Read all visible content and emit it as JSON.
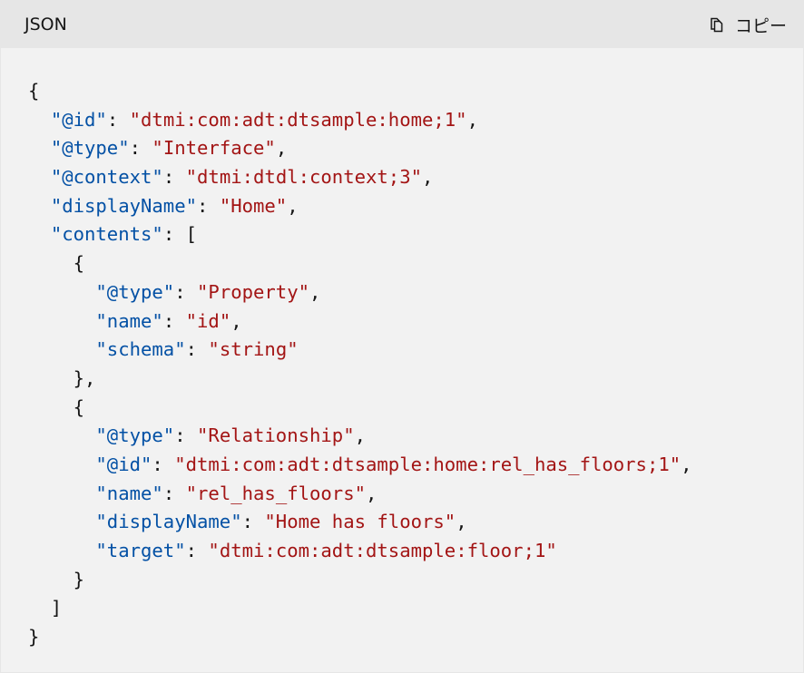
{
  "header": {
    "language": "JSON",
    "copy_label": "コピー"
  },
  "icons": {
    "copy": "copy-icon"
  },
  "colors": {
    "key": "#0451a5",
    "string": "#a31515",
    "punctuation": "#161616",
    "header_bg": "#e6e6e6",
    "code_bg": "#f2f2f2"
  },
  "code": {
    "lines": [
      [
        {
          "t": "p",
          "v": "{"
        }
      ],
      [
        {
          "t": "p",
          "v": "  "
        },
        {
          "t": "k",
          "v": "\"@id\""
        },
        {
          "t": "p",
          "v": ": "
        },
        {
          "t": "s",
          "v": "\"dtmi:com:adt:dtsample:home;1\""
        },
        {
          "t": "p",
          "v": ","
        }
      ],
      [
        {
          "t": "p",
          "v": "  "
        },
        {
          "t": "k",
          "v": "\"@type\""
        },
        {
          "t": "p",
          "v": ": "
        },
        {
          "t": "s",
          "v": "\"Interface\""
        },
        {
          "t": "p",
          "v": ","
        }
      ],
      [
        {
          "t": "p",
          "v": "  "
        },
        {
          "t": "k",
          "v": "\"@context\""
        },
        {
          "t": "p",
          "v": ": "
        },
        {
          "t": "s",
          "v": "\"dtmi:dtdl:context;3\""
        },
        {
          "t": "p",
          "v": ","
        }
      ],
      [
        {
          "t": "p",
          "v": "  "
        },
        {
          "t": "k",
          "v": "\"displayName\""
        },
        {
          "t": "p",
          "v": ": "
        },
        {
          "t": "s",
          "v": "\"Home\""
        },
        {
          "t": "p",
          "v": ","
        }
      ],
      [
        {
          "t": "p",
          "v": "  "
        },
        {
          "t": "k",
          "v": "\"contents\""
        },
        {
          "t": "p",
          "v": ": ["
        }
      ],
      [
        {
          "t": "p",
          "v": "    {"
        }
      ],
      [
        {
          "t": "p",
          "v": "      "
        },
        {
          "t": "k",
          "v": "\"@type\""
        },
        {
          "t": "p",
          "v": ": "
        },
        {
          "t": "s",
          "v": "\"Property\""
        },
        {
          "t": "p",
          "v": ","
        }
      ],
      [
        {
          "t": "p",
          "v": "      "
        },
        {
          "t": "k",
          "v": "\"name\""
        },
        {
          "t": "p",
          "v": ": "
        },
        {
          "t": "s",
          "v": "\"id\""
        },
        {
          "t": "p",
          "v": ","
        }
      ],
      [
        {
          "t": "p",
          "v": "      "
        },
        {
          "t": "k",
          "v": "\"schema\""
        },
        {
          "t": "p",
          "v": ": "
        },
        {
          "t": "s",
          "v": "\"string\""
        }
      ],
      [
        {
          "t": "p",
          "v": "    },"
        }
      ],
      [
        {
          "t": "p",
          "v": "    {"
        }
      ],
      [
        {
          "t": "p",
          "v": "      "
        },
        {
          "t": "k",
          "v": "\"@type\""
        },
        {
          "t": "p",
          "v": ": "
        },
        {
          "t": "s",
          "v": "\"Relationship\""
        },
        {
          "t": "p",
          "v": ","
        }
      ],
      [
        {
          "t": "p",
          "v": "      "
        },
        {
          "t": "k",
          "v": "\"@id\""
        },
        {
          "t": "p",
          "v": ": "
        },
        {
          "t": "s",
          "v": "\"dtmi:com:adt:dtsample:home:rel_has_floors;1\""
        },
        {
          "t": "p",
          "v": ","
        }
      ],
      [
        {
          "t": "p",
          "v": "      "
        },
        {
          "t": "k",
          "v": "\"name\""
        },
        {
          "t": "p",
          "v": ": "
        },
        {
          "t": "s",
          "v": "\"rel_has_floors\""
        },
        {
          "t": "p",
          "v": ","
        }
      ],
      [
        {
          "t": "p",
          "v": "      "
        },
        {
          "t": "k",
          "v": "\"displayName\""
        },
        {
          "t": "p",
          "v": ": "
        },
        {
          "t": "s",
          "v": "\"Home has floors\""
        },
        {
          "t": "p",
          "v": ","
        }
      ],
      [
        {
          "t": "p",
          "v": "      "
        },
        {
          "t": "k",
          "v": "\"target\""
        },
        {
          "t": "p",
          "v": ": "
        },
        {
          "t": "s",
          "v": "\"dtmi:com:adt:dtsample:floor;1\""
        }
      ],
      [
        {
          "t": "p",
          "v": "    }"
        }
      ],
      [
        {
          "t": "p",
          "v": "  ]"
        }
      ],
      [
        {
          "t": "p",
          "v": "}"
        }
      ]
    ]
  }
}
